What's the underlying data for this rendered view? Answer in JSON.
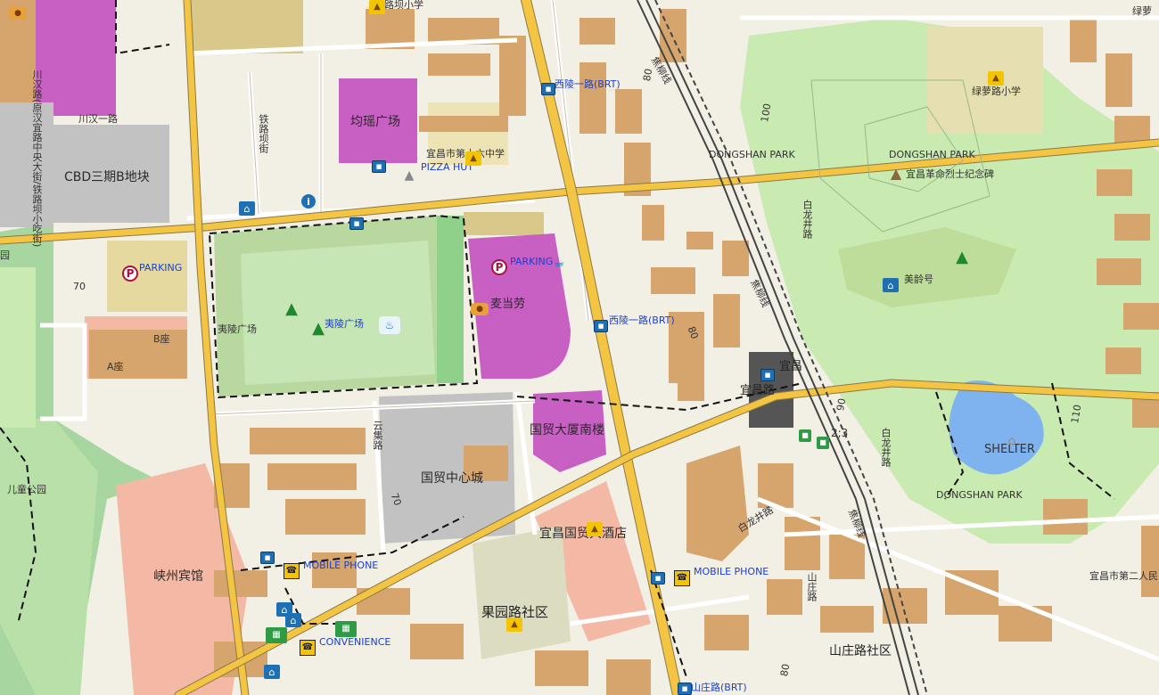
{
  "labels": {
    "chuanhan_road": "川汉一路",
    "chuanhan_vertical": "川汉路(原汉宜路中央大街/铁路坝小吃街)",
    "cbd": "CBD三期B地块",
    "railway_road": "铁路坝街",
    "junyao_plaza": "均瑶广场",
    "yichang_16th_school": "宜昌市第十六中学",
    "pizza_hut": "PIZZA HUT",
    "xiling_brt_top": "西陵一路(BRT)",
    "xiling_brt_mid": "西陵一路(BRT)",
    "dongshan_park_top": "DONGSHAN PARK",
    "dongshan_park_right": "DONGSHAN PARK",
    "dongshan_park_bottom": "DONGSHAN PARK",
    "martyrs_monument": "宜昌革命烈士纪念碑",
    "lvluo_school": "绿萝路小学",
    "lvluo_top": "绿萝",
    "school_top": "铁路坝小学",
    "parking_left": "PARKING",
    "parking_mid": "PARKING",
    "mcdonalds": "麦当劳",
    "yiling_plaza_a": "夷陵广场",
    "yiling_plaza_b": "夷陵广场",
    "block_b": "B座",
    "block_a": "A座",
    "guomao_south": "国贸大厦南楼",
    "guomao_center": "国贸中心城",
    "yunji_road": "云集路",
    "guomao_hotel": "宜昌国贸大酒店",
    "guoyuan_community": "果园路社区",
    "xiazhou_hotel": "峡州宾馆",
    "children_park": "儿童公园",
    "mobile_phone_1": "MOBILE PHONE",
    "mobile_phone_2": "MOBILE PHONE",
    "convenience": "CONVENIENCE",
    "shanzhuang_community": "山庄路社区",
    "shanzhuang_road": "山庄路",
    "shanzhuang_brt": "山庄路(BRT)",
    "bailongjing_road_1": "白龙井路",
    "bailongjing_road_2": "白龙井路",
    "bailongjing_road_3": "白龙井路",
    "yichang_station": "宜昌",
    "yichang_road": "宜昌路",
    "platform": "2;3",
    "shelter": "SHELTER",
    "meiling": "美龄号",
    "yichang_no2_people": "宜昌市第二人民",
    "line_rail_1": "焦柳线",
    "line_rail_2": "焦柳线",
    "line_rail_3": "焦柳线",
    "num_70_left": "70",
    "num_70_center": "70",
    "num_80_top": "80",
    "num_80_mid": "80",
    "num_80_bottom": "80",
    "num_90": "90",
    "num_100": "100",
    "num_110": "110",
    "edge_left": "园"
  },
  "icons": [
    "bus-stop-icon",
    "parking-icon",
    "museum-icon",
    "info-icon",
    "tree-icon",
    "fast-food-icon",
    "phone-shop-icon",
    "convenience-store-icon",
    "school-icon",
    "cafe-icon",
    "fountain-icon",
    "monument-icon",
    "shelter-icon",
    "train-icon",
    "restaurant-icon"
  ],
  "colors": {
    "background": "#f2efe5",
    "park": "#c9eab1",
    "park_dark": "#b3dd96",
    "forest": "#a8d6a0",
    "building": "#d6a56d",
    "commercial": "#c85fc2",
    "parking_lot": "#c2c2c2",
    "residential_pink": "#f3b9a5",
    "plaza": "#b9d8a0",
    "water": "#7fb3f0",
    "major_road": "#f4c542",
    "road_outline": "#8a7a48",
    "railway": "#444444",
    "tan_area": "#d8c98a",
    "school": "#f0e9c8"
  }
}
